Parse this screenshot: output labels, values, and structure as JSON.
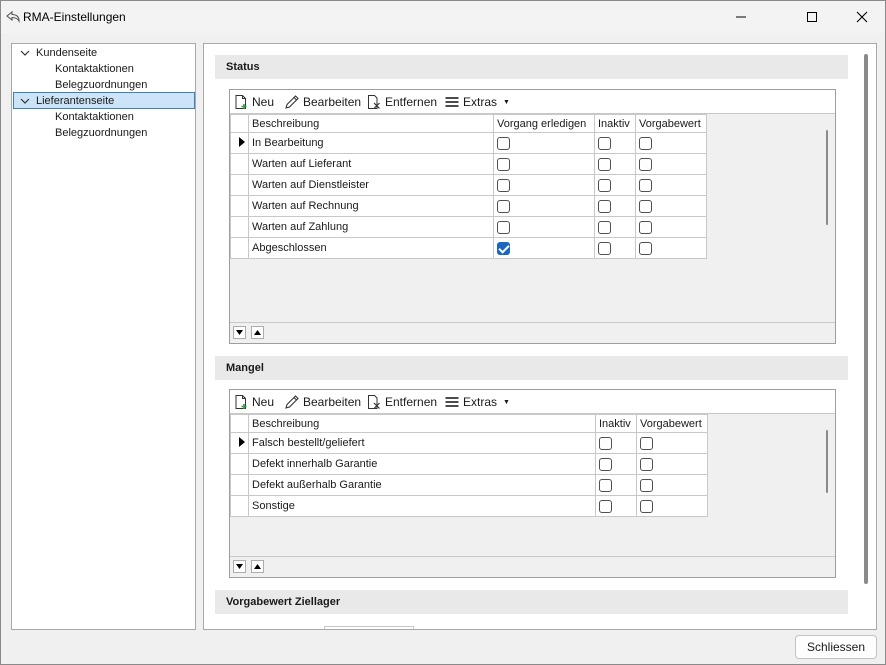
{
  "window": {
    "title": "RMA-Einstellungen"
  },
  "tree": {
    "nodes": [
      {
        "label": "Kundenseite",
        "expanded": true
      },
      {
        "label": "Kontaktaktionen"
      },
      {
        "label": "Belegzuordnungen"
      },
      {
        "label": "Lieferantenseite",
        "expanded": true,
        "selected": true
      },
      {
        "label": "Kontaktaktionen"
      },
      {
        "label": "Belegzuordnungen"
      }
    ]
  },
  "toolbar": {
    "neu_label": "Neu",
    "bearbeiten_label": "Bearbeiten",
    "entfernen_label": "Entfernen",
    "extras_label": "Extras"
  },
  "status": {
    "header": "Status",
    "columns": [
      "Beschreibung",
      "Vorgang erledigen",
      "Inaktiv",
      "Vorgabewert"
    ],
    "rows": [
      {
        "beschreibung": "In Bearbeitung",
        "vorgang_erledigen": false,
        "inaktiv": false,
        "vorgabewert": false,
        "current": true
      },
      {
        "beschreibung": "Warten auf Lieferant",
        "vorgang_erledigen": false,
        "inaktiv": false,
        "vorgabewert": false
      },
      {
        "beschreibung": "Warten auf Dienstleister",
        "vorgang_erledigen": false,
        "inaktiv": false,
        "vorgabewert": false
      },
      {
        "beschreibung": "Warten auf Rechnung",
        "vorgang_erledigen": false,
        "inaktiv": false,
        "vorgabewert": false
      },
      {
        "beschreibung": "Warten auf Zahlung",
        "vorgang_erledigen": false,
        "inaktiv": false,
        "vorgabewert": false
      },
      {
        "beschreibung": "Abgeschlossen",
        "vorgang_erledigen": true,
        "inaktiv": false,
        "vorgabewert": false
      }
    ]
  },
  "mangel": {
    "header": "Mangel",
    "columns": [
      "Beschreibung",
      "Inaktiv",
      "Vorgabewert"
    ],
    "rows": [
      {
        "beschreibung": "Falsch bestellt/geliefert",
        "inaktiv": false,
        "vorgabewert": false,
        "current": true
      },
      {
        "beschreibung": "Defekt innerhalb Garantie",
        "inaktiv": false,
        "vorgabewert": false
      },
      {
        "beschreibung": "Defekt außerhalb Garantie",
        "inaktiv": false,
        "vorgabewert": false
      },
      {
        "beschreibung": "Sonstige",
        "inaktiv": false,
        "vorgabewert": false
      }
    ]
  },
  "ziellager": {
    "header": "Vorgabewert Ziellager"
  },
  "footer": {
    "close_label": "Schliessen"
  },
  "colors": {
    "selection": "#cce4f7",
    "checkbox_checked": "#1a66c2",
    "section_header_bg": "#e9e9e9"
  }
}
